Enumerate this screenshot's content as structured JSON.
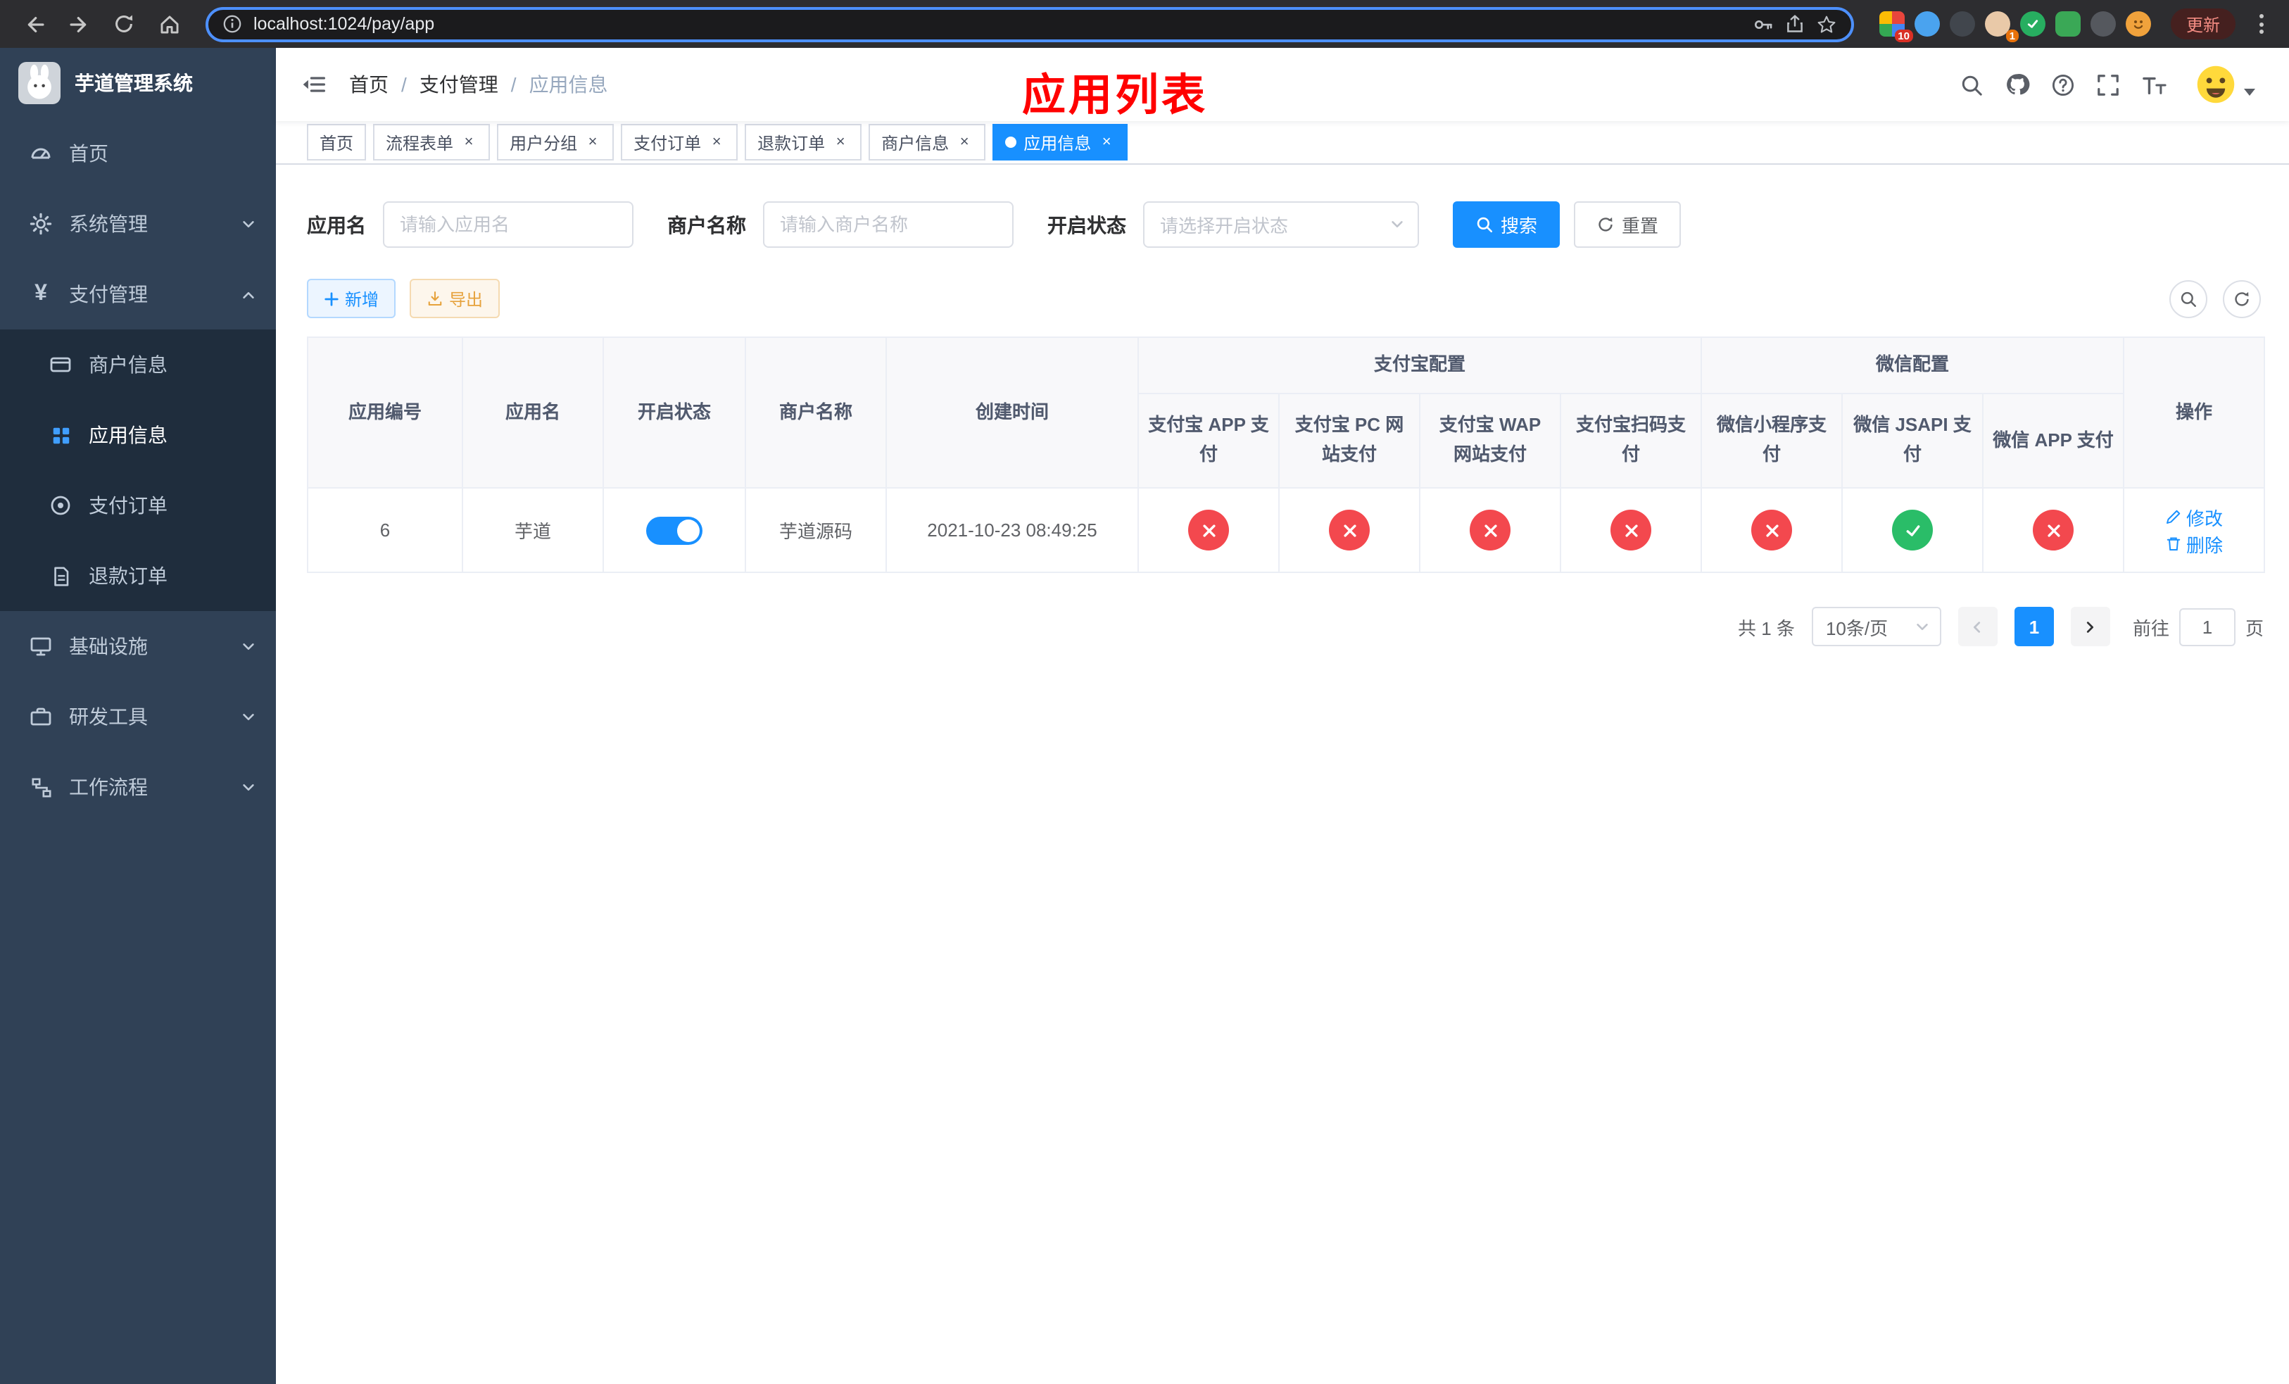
{
  "colors": {
    "primary": "#1890ff",
    "danger": "#f3484e",
    "success": "#2abd68",
    "export_accent": "#e6a23c",
    "annotation": "#ff0000",
    "sidebar_bg": "#304156",
    "submenu_bg": "#1f2d3d"
  },
  "browser": {
    "url": "localhost:1024/pay/app",
    "update_label": "更新",
    "extensions_badge": "10",
    "profile_badge": "1"
  },
  "sidebar": {
    "title": "芋道管理系统",
    "items": [
      {
        "label": "首页"
      },
      {
        "label": "系统管理"
      },
      {
        "label": "支付管理"
      },
      {
        "label": "商户信息"
      },
      {
        "label": "应用信息"
      },
      {
        "label": "支付订单"
      },
      {
        "label": "退款订单"
      },
      {
        "label": "基础设施"
      },
      {
        "label": "研发工具"
      },
      {
        "label": "工作流程"
      }
    ]
  },
  "navbar": {
    "breadcrumb": [
      "首页",
      "支付管理",
      "应用信息"
    ],
    "separator": "/",
    "annotation": "应用列表"
  },
  "tabs": [
    {
      "label": "首页"
    },
    {
      "label": "流程表单"
    },
    {
      "label": "用户分组"
    },
    {
      "label": "支付订单"
    },
    {
      "label": "退款订单"
    },
    {
      "label": "商户信息"
    },
    {
      "label": "应用信息"
    }
  ],
  "filters": {
    "app_name_label": "应用名",
    "app_name_placeholder": "请输入应用名",
    "merchant_label": "商户名称",
    "merchant_placeholder": "请输入商户名称",
    "status_label": "开启状态",
    "status_placeholder": "请选择开启状态",
    "search_label": "搜索",
    "reset_label": "重置"
  },
  "toolbar": {
    "add_label": "新增",
    "export_label": "导出"
  },
  "table": {
    "columns": {
      "id": "应用编号",
      "name": "应用名",
      "status": "开启状态",
      "merchant": "商户名称",
      "created": "创建时间",
      "alipay_group": "支付宝配置",
      "wechat_group": "微信配置",
      "alipay": [
        "支付宝 APP 支付",
        "支付宝 PC 网站支付",
        "支付宝 WAP 网站支付",
        "支付宝扫码支付"
      ],
      "wechat": [
        "微信小程序支付",
        "微信 JSAPI 支付",
        "微信 APP 支付"
      ],
      "actions": "操作"
    },
    "row": {
      "id": "6",
      "name": "芋道",
      "enabled": true,
      "merchant": "芋道源码",
      "created": "2021-10-23 08:49:25",
      "channels": [
        false,
        false,
        false,
        false,
        false,
        true,
        false
      ],
      "edit": "修改",
      "delete": "删除"
    }
  },
  "pagination": {
    "total": "共 1 条",
    "page_size": "10条/页",
    "page": "1",
    "goto_label": "前往",
    "goto_value": "1",
    "goto_unit": "页"
  }
}
